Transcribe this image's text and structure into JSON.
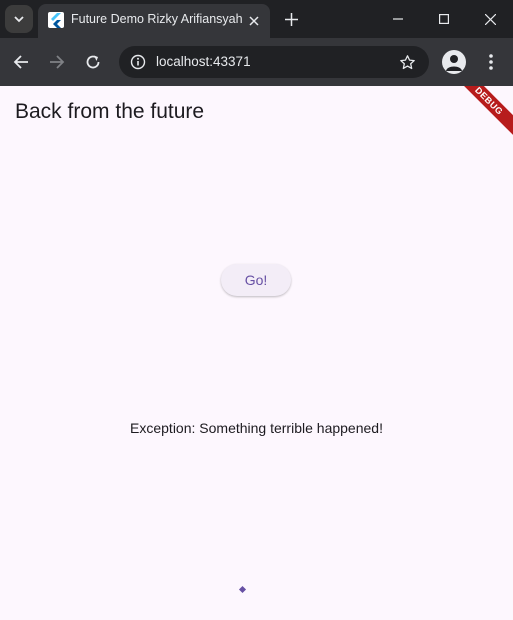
{
  "browser": {
    "tab_title": "Future Demo Rizky Arifiansyah",
    "url": "localhost:43371"
  },
  "icons": {
    "tab_list": "chevron-down-icon",
    "favicon": "flutter-icon",
    "tab_close": "close-icon",
    "new_tab": "plus-icon",
    "minimize": "minimize-icon",
    "maximize": "maximize-icon",
    "close_window": "close-icon",
    "back": "arrow-left-icon",
    "forward": "arrow-right-icon",
    "reload": "reload-icon",
    "site_info": "info-icon",
    "bookmark": "star-icon",
    "profile": "person-icon",
    "menu": "kebab-menu-icon"
  },
  "app": {
    "title": "Back from the future",
    "go_label": "Go!",
    "result_text": "Exception: Something terrible happened!",
    "debug_banner": "DEBUG"
  },
  "colors": {
    "background": "#fdf7fe",
    "accent": "#6750a4",
    "button_bg": "#f3edf7",
    "banner": "#b71c1c"
  }
}
